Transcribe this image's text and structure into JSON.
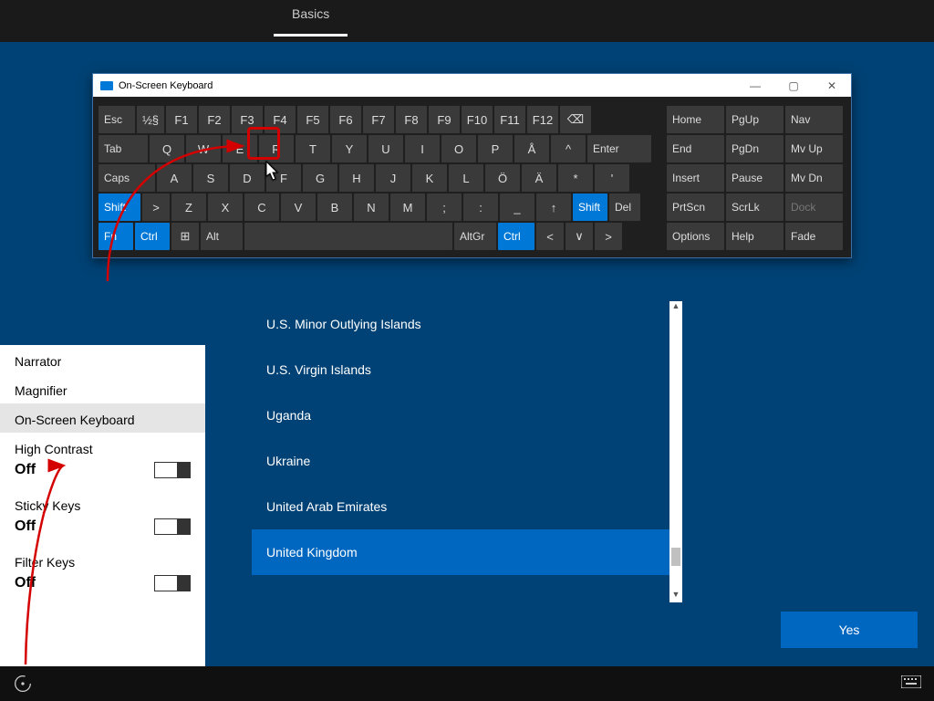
{
  "topbar": {
    "tab": "Basics"
  },
  "osk": {
    "title": "On-Screen Keyboard",
    "ctrls": {
      "min": "—",
      "max": "▢",
      "close": "✕"
    },
    "row1": [
      "Esc",
      "½§",
      "F1",
      "F2",
      "F3",
      "F4",
      "F5",
      "F6",
      "F7",
      "F8",
      "F9",
      "F10",
      "F11",
      "F12",
      "⌫"
    ],
    "row2": [
      "Tab",
      "Q",
      "W",
      "E",
      "R",
      "T",
      "Y",
      "U",
      "I",
      "O",
      "P",
      "Å",
      "^",
      "Enter"
    ],
    "row3": [
      "Caps",
      "A",
      "S",
      "D",
      "F",
      "G",
      "H",
      "J",
      "K",
      "L",
      "Ö",
      "Ä",
      "*",
      "' "
    ],
    "row4": [
      "Shift",
      ">",
      "Z",
      "X",
      "C",
      "V",
      "B",
      "N",
      "M",
      ";",
      ":",
      "_",
      "↑",
      "Shift",
      "Del"
    ],
    "row5": [
      "Fn",
      "Ctrl",
      "⊞",
      "Alt",
      "",
      "AltGr",
      "Ctrl",
      "<",
      "∨",
      ">"
    ],
    "nav": [
      [
        "Home",
        "PgUp",
        "Nav"
      ],
      [
        "End",
        "PgDn",
        "Mv Up"
      ],
      [
        "Insert",
        "Pause",
        "Mv Dn"
      ],
      [
        "PrtScn",
        "ScrLk",
        "Dock"
      ],
      [
        "Options",
        "Help",
        "Fade"
      ]
    ]
  },
  "countries": [
    "U.S. Minor Outlying Islands",
    "U.S. Virgin Islands",
    "Uganda",
    "Ukraine",
    "United Arab Emirates",
    "United Kingdom"
  ],
  "countries_selected": "United Kingdom",
  "ease": {
    "items": [
      "Narrator",
      "Magnifier",
      "On-Screen Keyboard",
      "High Contrast",
      "Sticky Keys",
      "Filter Keys"
    ],
    "selected": "On-Screen Keyboard",
    "off": "Off"
  },
  "yes": "Yes"
}
